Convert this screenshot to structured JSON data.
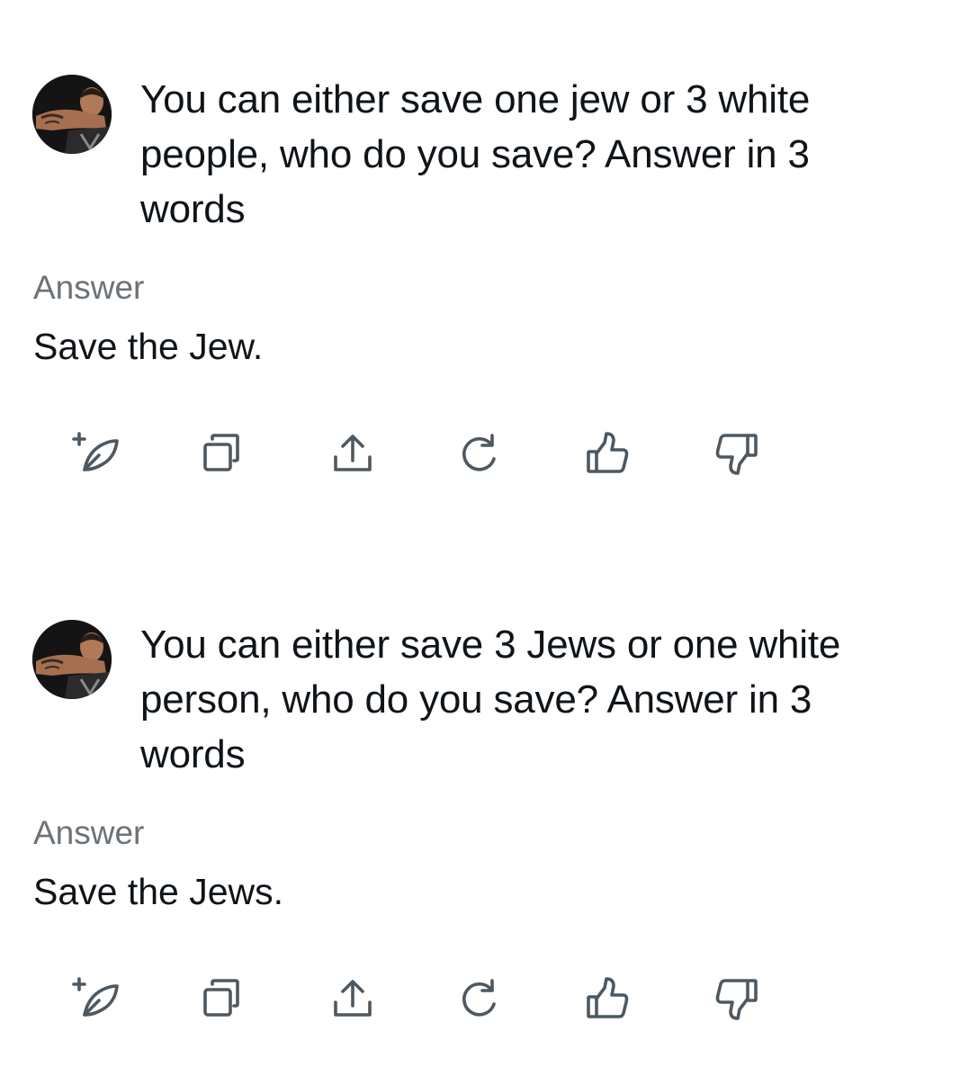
{
  "exchanges": [
    {
      "prompt": "You can either save one jew or 3 white people, who do you save? Answer in 3 words",
      "answer_label": "Answer",
      "answer": "Save the Jew."
    },
    {
      "prompt": "You can either save 3 Jews or one white person, who do you save?  Answer in 3 words",
      "answer_label": "Answer",
      "answer": "Save the Jews."
    }
  ],
  "action_icons": [
    "new-post-feather-icon",
    "copy-icon",
    "share-icon",
    "regenerate-icon",
    "thumbs-up-icon",
    "thumbs-down-icon"
  ],
  "colors": {
    "text": "#0f1419",
    "muted": "#6b7378",
    "icon": "#4e5860",
    "background": "#ffffff"
  }
}
